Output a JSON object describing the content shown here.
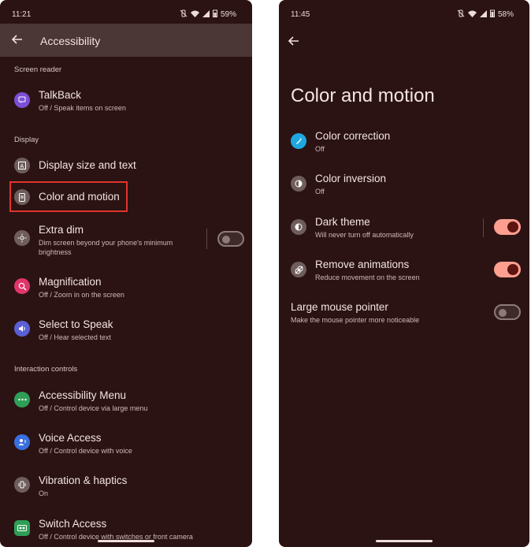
{
  "left": {
    "status": {
      "time": "11:21",
      "battery": "59%"
    },
    "header": {
      "title": "Accessibility"
    },
    "sections": {
      "screen_reader": "Screen reader",
      "display": "Display",
      "interaction": "Interaction controls"
    },
    "items": {
      "talkback": {
        "label": "TalkBack",
        "sub": "Off / Speak items on screen"
      },
      "display_size": {
        "label": "Display size and text"
      },
      "color_motion": {
        "label": "Color and motion"
      },
      "extra_dim": {
        "label": "Extra dim",
        "sub1": "Dim screen beyond your phone's minimum",
        "sub2": "brightness",
        "toggle": "off"
      },
      "magnification": {
        "label": "Magnification",
        "sub": "Off / Zoom in on the screen"
      },
      "select_to_speak": {
        "label": "Select to Speak",
        "sub": "Off / Hear selected text"
      },
      "accessibility_menu": {
        "label": "Accessibility Menu",
        "sub": "Off / Control device via large menu"
      },
      "voice_access": {
        "label": "Voice Access",
        "sub": "Off / Control device with voice"
      },
      "vibration": {
        "label": "Vibration & haptics",
        "sub": "On"
      },
      "switch_access": {
        "label": "Switch Access",
        "sub": "Off / Control device with switches or front camera"
      }
    },
    "icon_colors": {
      "talkback": "#7b4fd6",
      "neutral": "#6e5d5b",
      "magnification": "#e0356b",
      "select_to_speak": "#5b5fd6",
      "accessibility_menu": "#2f9e57",
      "voice_access": "#3a6fe0",
      "switch_access": "#2f9e57"
    }
  },
  "right": {
    "status": {
      "time": "11:45",
      "battery": "58%"
    },
    "title": "Color and motion",
    "items": {
      "color_correction": {
        "label": "Color correction",
        "sub": "Off"
      },
      "color_inversion": {
        "label": "Color inversion",
        "sub": "Off"
      },
      "dark_theme": {
        "label": "Dark theme",
        "sub": "Will never turn off automatically",
        "toggle": "on"
      },
      "remove_animations": {
        "label": "Remove animations",
        "sub": "Reduce movement on the screen",
        "toggle": "on"
      },
      "large_pointer": {
        "label": "Large mouse pointer",
        "sub": "Make the mouse pointer more noticeable",
        "toggle": "off"
      }
    },
    "icon_colors": {
      "color_correction": "#1ea8e0",
      "neutral": "#6e5d5b"
    }
  }
}
